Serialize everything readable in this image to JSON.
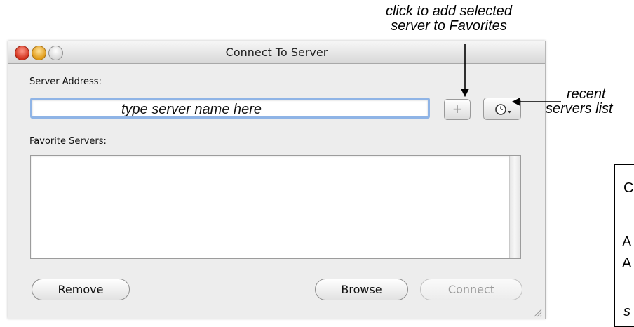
{
  "annotations": {
    "top_line1": "click to add selected",
    "top_line2": "server to Favorites",
    "right_line1": "recent",
    "right_line2": "servers list"
  },
  "window": {
    "title": "Connect To Server",
    "server_address_label": "Server Address:",
    "server_address_hint": "type server name here",
    "add_button_label": "+",
    "favorite_servers_label": "Favorite Servers:",
    "favorites": [],
    "buttons": {
      "remove": "Remove",
      "browse": "Browse",
      "connect": "Connect"
    }
  },
  "sidebox": {
    "c1": "C",
    "c2": "A",
    "c3": "A",
    "c4": "s"
  },
  "icons": [
    "close-icon",
    "minimize-icon",
    "zoom-icon",
    "plus-icon",
    "clock-icon",
    "resize-grip-icon"
  ]
}
